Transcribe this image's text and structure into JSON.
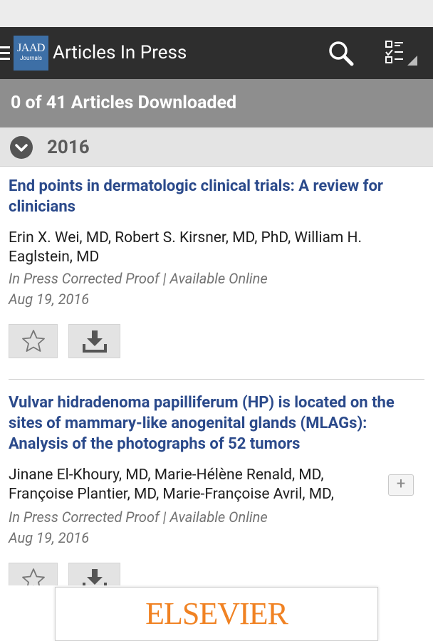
{
  "app_bar": {
    "logo_line1": "JAAD",
    "logo_line2": "Journals",
    "title": "Articles In Press",
    "search_icon": "search-icon",
    "view_toggle_icon": "list-view-icon"
  },
  "download_banner": {
    "text": "0 of 41 Articles Downloaded"
  },
  "year_group": {
    "label": "2016",
    "icon": "chevron-down-icon"
  },
  "articles": [
    {
      "title": "End points in dermatologic clinical trials: A review for clinicians",
      "authors": "Erin X. Wei, MD, Robert S. Kirsner, MD, PhD, William H. Eaglstein, MD",
      "status": "In Press Corrected Proof | Available Online",
      "date": "Aug 19, 2016"
    },
    {
      "title": "Vulvar hidradenoma papilliferum (HP) is located on the sites of mammary-like anogenital glands (MLAGs): Analysis of the photographs of 52 tumors",
      "authors": "Jinane El-Khoury, MD, Marie-Hélène Renald, MD, Françoise Plantier, MD, Marie-Françoise Avril, MD,",
      "expand_label": "+",
      "status": "In Press Corrected Proof | Available Online",
      "date": "Aug 19, 2016"
    }
  ],
  "footer": {
    "publisher": "ELSEVIER"
  },
  "colors": {
    "app_bar": "#2e2e2e",
    "banner": "#8e8e8e",
    "title_link": "#2b4a8b",
    "logo_bg": "#3d6fa6",
    "publisher": "#f08223"
  }
}
